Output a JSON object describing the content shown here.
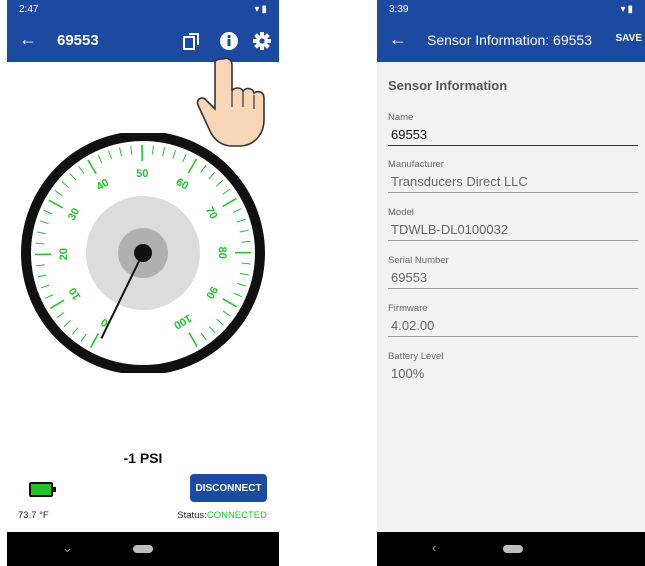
{
  "left": {
    "status_time": "2:47",
    "title": "69553",
    "icons": {
      "back": "arrow-back-icon",
      "copy": "copy-icon",
      "info": "info-icon",
      "settings": "gear-icon"
    },
    "pressure": "-1 PSI",
    "disconnect_label": "DISCONNECT",
    "temperature": "73.7 °F",
    "status_label": "Status:",
    "status_value": "CONNECTED",
    "gauge": {
      "tick_labels": [
        "0",
        "10",
        "20",
        "30",
        "40",
        "50",
        "60",
        "70",
        "80",
        "90",
        "100"
      ],
      "min": 0,
      "max": 100,
      "value": -1,
      "colors": {
        "ticks": "#22c42a",
        "rim": "#111111"
      }
    }
  },
  "right": {
    "status_time": "3:39",
    "title": "Sensor Information: 69553",
    "save_label": "SAVE",
    "section_title": "Sensor Information",
    "fields": [
      {
        "label": "Name",
        "value": "69553"
      },
      {
        "label": "Manufacturer",
        "value": "Transducers Direct LLC"
      },
      {
        "label": "Model",
        "value": "TDWLB-DL0100032"
      },
      {
        "label": "Serial Number",
        "value": "69553"
      },
      {
        "label": "Firmware",
        "value": "4.02.00"
      },
      {
        "label": "Battery Level",
        "value": "100%"
      }
    ]
  },
  "colors": {
    "brand": "#1c4aa0",
    "connected": "#22c42a"
  }
}
